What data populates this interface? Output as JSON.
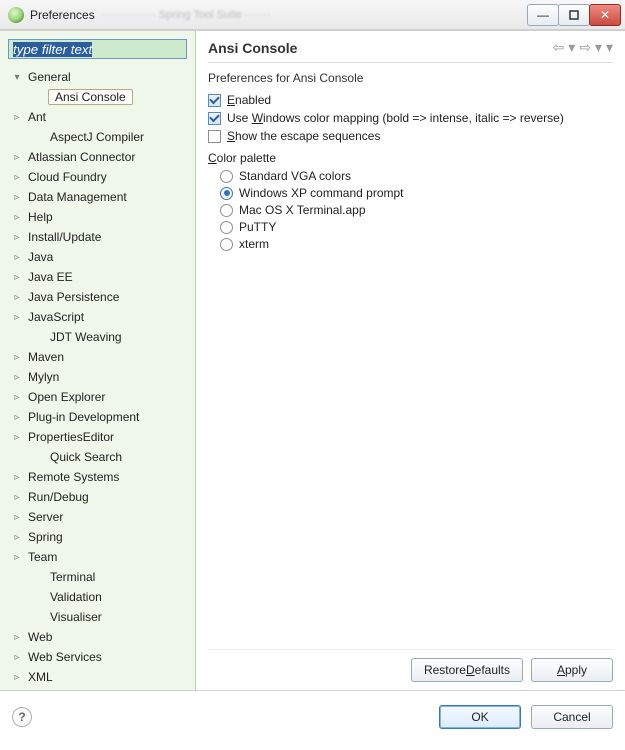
{
  "window": {
    "title": "Preferences"
  },
  "sidebar": {
    "filter_placeholder": "type filter text",
    "items": [
      {
        "label": "General",
        "expandable": true,
        "expanded": true,
        "level": 0
      },
      {
        "label": "Ansi Console",
        "expandable": false,
        "level": 1,
        "selected": true
      },
      {
        "label": "Ant",
        "expandable": true,
        "level": 0
      },
      {
        "label": "AspectJ Compiler",
        "expandable": false,
        "level": 1
      },
      {
        "label": "Atlassian Connector",
        "expandable": true,
        "level": 0
      },
      {
        "label": "Cloud Foundry",
        "expandable": true,
        "level": 0
      },
      {
        "label": "Data Management",
        "expandable": true,
        "level": 0
      },
      {
        "label": "Help",
        "expandable": true,
        "level": 0
      },
      {
        "label": "Install/Update",
        "expandable": true,
        "level": 0
      },
      {
        "label": "Java",
        "expandable": true,
        "level": 0
      },
      {
        "label": "Java EE",
        "expandable": true,
        "level": 0
      },
      {
        "label": "Java Persistence",
        "expandable": true,
        "level": 0
      },
      {
        "label": "JavaScript",
        "expandable": true,
        "level": 0
      },
      {
        "label": "JDT Weaving",
        "expandable": false,
        "level": 1
      },
      {
        "label": "Maven",
        "expandable": true,
        "level": 0
      },
      {
        "label": "Mylyn",
        "expandable": true,
        "level": 0
      },
      {
        "label": "Open Explorer",
        "expandable": true,
        "level": 0
      },
      {
        "label": "Plug-in Development",
        "expandable": true,
        "level": 0
      },
      {
        "label": "PropertiesEditor",
        "expandable": true,
        "level": 0
      },
      {
        "label": "Quick Search",
        "expandable": false,
        "level": 1
      },
      {
        "label": "Remote Systems",
        "expandable": true,
        "level": 0
      },
      {
        "label": "Run/Debug",
        "expandable": true,
        "level": 0
      },
      {
        "label": "Server",
        "expandable": true,
        "level": 0
      },
      {
        "label": "Spring",
        "expandable": true,
        "level": 0
      },
      {
        "label": "Team",
        "expandable": true,
        "level": 0
      },
      {
        "label": "Terminal",
        "expandable": false,
        "level": 1
      },
      {
        "label": "Validation",
        "expandable": false,
        "level": 1
      },
      {
        "label": "Visualiser",
        "expandable": false,
        "level": 1
      },
      {
        "label": "Web",
        "expandable": true,
        "level": 0
      },
      {
        "label": "Web Services",
        "expandable": true,
        "level": 0
      },
      {
        "label": "XML",
        "expandable": true,
        "level": 0
      }
    ]
  },
  "page": {
    "title": "Ansi Console",
    "description": "Preferences for Ansi Console",
    "checkboxes": {
      "enabled": {
        "label_pre": "",
        "mnemonic": "E",
        "label_post": "nabled",
        "checked": true
      },
      "winmap": {
        "label_pre": "Use ",
        "mnemonic": "W",
        "label_post": "indows color mapping (bold => intense, italic => reverse)",
        "checked": true
      },
      "escape": {
        "label_pre": "",
        "mnemonic": "S",
        "label_post": "how the escape sequences",
        "checked": false
      }
    },
    "palette": {
      "group_pre": "",
      "group_mn": "C",
      "group_post": "olor palette",
      "options": [
        {
          "label": "Standard VGA colors",
          "selected": false
        },
        {
          "label": "Windows XP command prompt",
          "selected": true
        },
        {
          "label": "Mac OS X Terminal.app",
          "selected": false
        },
        {
          "label": "PuTTY",
          "selected": false
        },
        {
          "label": "xterm",
          "selected": false
        }
      ]
    },
    "buttons": {
      "restore_pre": "Restore ",
      "restore_mn": "D",
      "restore_post": "efaults",
      "apply_mn": "A",
      "apply_post": "pply"
    }
  },
  "dialog": {
    "ok": "OK",
    "cancel": "Cancel"
  }
}
